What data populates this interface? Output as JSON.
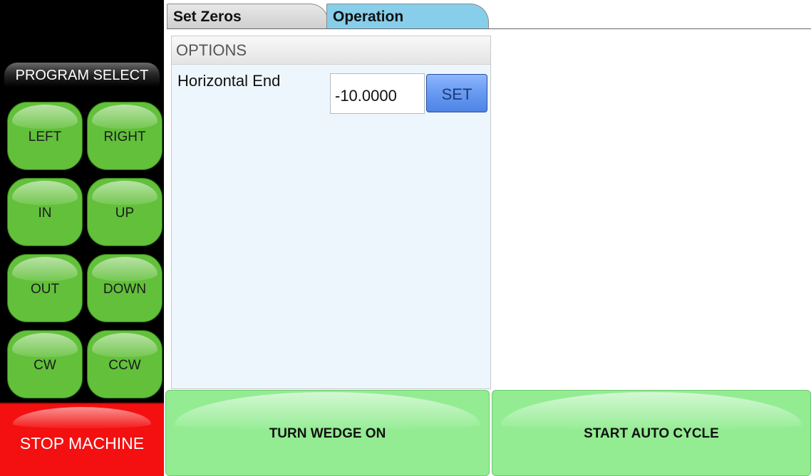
{
  "tabs": {
    "set_zeros": "Set Zeros",
    "operation": "Operation"
  },
  "sidebar": {
    "program_select": "PROGRAM SELECT",
    "buttons": [
      "LEFT",
      "RIGHT",
      "IN",
      "UP",
      "OUT",
      "DOWN",
      "CW",
      "CCW"
    ],
    "stop": "STOP MACHINE"
  },
  "options": {
    "header": "OPTIONS",
    "horizontal_end_label": "Horizontal End",
    "horizontal_end_value": "-10.0000",
    "set_label": "SET"
  },
  "actions": {
    "wedge": "TURN WEDGE ON",
    "auto_cycle": "START AUTO CYCLE"
  },
  "colors": {
    "jog_green": "#62c03a",
    "stop_red": "#f41010",
    "action_green": "#93ec92",
    "active_tab": "#87ceeb",
    "set_blue": "#6b9cf2"
  }
}
